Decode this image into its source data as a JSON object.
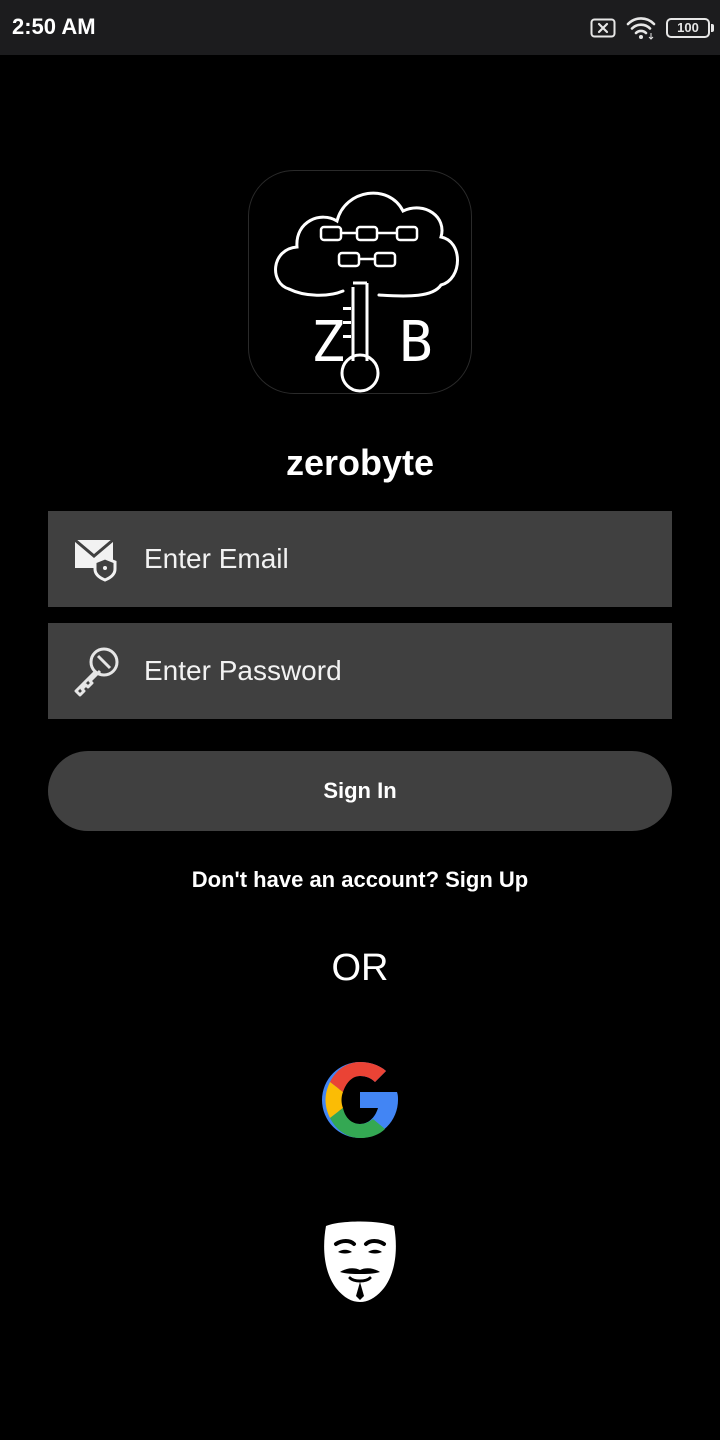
{
  "status_bar": {
    "time": "2:50 AM",
    "icons": [
      "sim-error-icon",
      "wifi-icon",
      "battery-icon"
    ],
    "battery_level": "100"
  },
  "app": {
    "logo_icon": "zerobyte-cloud-key-logo",
    "logo_letter_left": "Z",
    "logo_letter_right": "B",
    "name": "zerobyte"
  },
  "login_form": {
    "email_icon": "mail-shield-icon",
    "email_placeholder": "Enter Email",
    "email_value": "",
    "password_icon": "key-icon",
    "password_placeholder": "Enter Password",
    "password_value": "",
    "signin_label": "Sign In",
    "signup_prompt": "Don't have an account? Sign Up"
  },
  "alternatives": {
    "or_label": "OR",
    "google_icon": "google-g-icon",
    "anonymous_icon": "guy-fawkes-mask-icon"
  },
  "colors": {
    "background": "#000000",
    "status_bar": "#1c1c1e",
    "field_background": "#404040",
    "button_background": "#404040",
    "text": "#ffffff"
  }
}
